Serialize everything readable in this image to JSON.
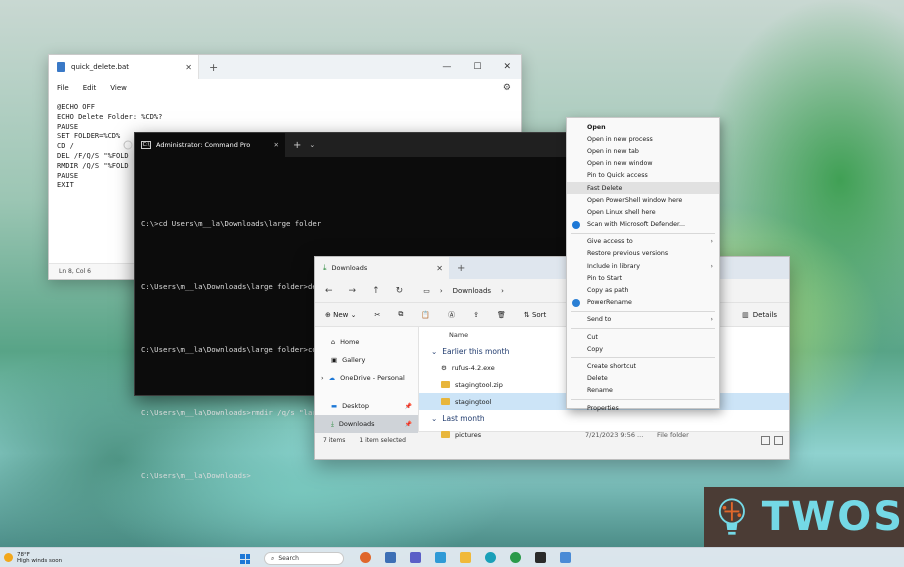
{
  "notepad": {
    "tab_title": "quick_delete.bat",
    "menu": [
      "File",
      "Edit",
      "View"
    ],
    "content": "@ECHO OFF\nECHO Delete Folder: %CD%?\nPAUSE\nSET FOLDER=%CD%\nCD /\nDEL /F/Q/S \"%FOLD\nRMDIR /Q/S \"%FOLD\nPAUSE\nEXIT",
    "status": "Ln 8, Col 6"
  },
  "terminal": {
    "tab_title": "Administrator: Command Pro",
    "lines": [
      "C:\\>cd Users\\m__la\\Downloads\\large folder",
      "C:\\Users\\m__la\\Downloads\\large folder>del /f/q/s *.* > nul",
      "C:\\Users\\m__la\\Downloads\\large folder>cd ..",
      "C:\\Users\\m__la\\Downloads>rmdir /q/s \"large folder\"",
      "C:\\Users\\m__la\\Downloads>"
    ]
  },
  "explorer": {
    "tab_title": "Downloads",
    "breadcrumb": "Downloads",
    "new_label": "New",
    "sort_label": "Sort",
    "details_label": "Details",
    "nav": [
      {
        "label": "Home",
        "pinned": false
      },
      {
        "label": "Gallery",
        "pinned": false
      },
      {
        "label": "OneDrive - Personal",
        "pinned": false
      },
      {
        "label": "Desktop",
        "pinned": true
      },
      {
        "label": "Downloads",
        "pinned": true
      }
    ],
    "column_name": "Name",
    "groups": [
      {
        "label": "Earlier this month"
      },
      {
        "label": "Last month"
      }
    ],
    "files": [
      {
        "name": "rufus-4.2.exe",
        "date": "",
        "type": ""
      },
      {
        "name": "stagingtool.zip",
        "date": "",
        "type": ""
      },
      {
        "name": "stagingtool",
        "date": "",
        "type": "File folder"
      },
      {
        "name": "pictures",
        "date": "7/21/2023 9:56 ...",
        "type": "File folder"
      }
    ],
    "status_items": "7 items",
    "status_selected": "1 item selected"
  },
  "context_menu": {
    "items": [
      {
        "label": "Open",
        "bold": true
      },
      {
        "label": "Open in new process"
      },
      {
        "label": "Open in new tab"
      },
      {
        "label": "Open in new window"
      },
      {
        "label": "Pin to Quick access"
      },
      {
        "label": "Fast Delete",
        "highlighted": true
      },
      {
        "label": "Open PowerShell window here"
      },
      {
        "label": "Open Linux shell here"
      },
      {
        "label": "Scan with Microsoft Defender...",
        "icon": "defender-icon"
      },
      {
        "separator": true
      },
      {
        "label": "Give access to",
        "submenu": true
      },
      {
        "label": "Restore previous versions"
      },
      {
        "label": "Include in library",
        "submenu": true
      },
      {
        "label": "Pin to Start"
      },
      {
        "label": "Copy as path"
      },
      {
        "label": "PowerRename",
        "icon": "powerrename-icon"
      },
      {
        "separator": true
      },
      {
        "label": "Send to",
        "submenu": true
      },
      {
        "separator": true
      },
      {
        "label": "Cut"
      },
      {
        "label": "Copy"
      },
      {
        "separator": true
      },
      {
        "label": "Create shortcut"
      },
      {
        "label": "Delete"
      },
      {
        "label": "Rename"
      },
      {
        "separator": true
      },
      {
        "label": "Properties"
      }
    ]
  },
  "taskbar": {
    "temperature": "78°F",
    "weather_text": "High winds soon",
    "search_placeholder": "Search"
  },
  "watermark": {
    "text": "TWOS"
  },
  "colors": {
    "accent": "#1e78d6",
    "watermark_bg": "#4b3c35",
    "watermark_text": "#74d9e6",
    "selection": "#cce4f7"
  }
}
